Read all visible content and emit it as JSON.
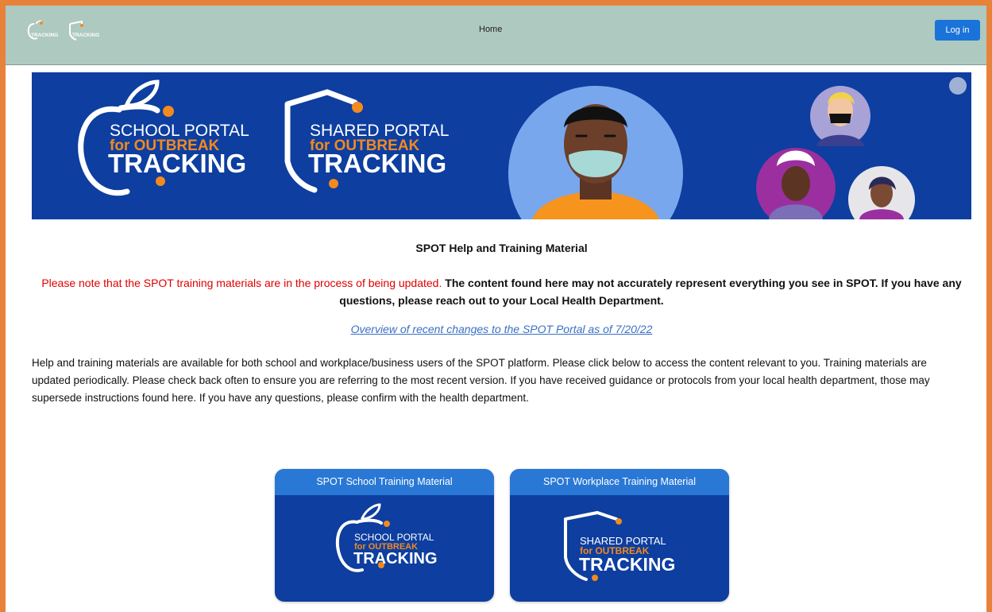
{
  "header": {
    "nav_home": "Home",
    "login_label": "Log in",
    "logo_small_1": "TRACKING",
    "logo_small_2": "TRACKING"
  },
  "banner": {
    "logo1": {
      "line1": "SCHOOL PORTAL",
      "line2": "for OUTBREAK",
      "line3": "TRACKING"
    },
    "logo2": {
      "line1": "SHARED PORTAL",
      "line2": "for OUTBREAK",
      "line3": "TRACKING"
    }
  },
  "main": {
    "title": "SPOT Help and Training Material",
    "notice_red": "Please note that the SPOT training materials are in the process of being updated.",
    "notice_rest": " The content found here may not accurately represent everything you see in SPOT. If you have any questions, please reach out to your Local Health Department.",
    "overview_link": "Overview of recent changes to the SPOT Portal as of 7/20/22",
    "paragraph": "Help and training materials are available for both school and workplace/business users of the SPOT platform. Please click below to access the content relevant to you. Training materials are updated periodically. Please check back often to ensure you are referring to the most recent version. If you have received guidance or protocols from your local health department, those may supersede instructions found here. If you have any questions, please confirm with the health department."
  },
  "cards": [
    {
      "title": "SPOT School Training Material",
      "logo": {
        "line1": "SCHOOL PORTAL",
        "line2": "for OUTBREAK",
        "line3": "TRACKING"
      }
    },
    {
      "title": "SPOT Workplace Training Material",
      "logo": {
        "line1": "SHARED PORTAL",
        "line2": "for OUTBREAK",
        "line3": "TRACKING"
      }
    }
  ],
  "colors": {
    "frame": "#e8823a",
    "topbar": "#aec9c0",
    "banner": "#0d3ea0",
    "accent_orange": "#f28a1e",
    "button": "#1a73d9",
    "notice_red": "#e00000",
    "link": "#3a6fc4"
  }
}
